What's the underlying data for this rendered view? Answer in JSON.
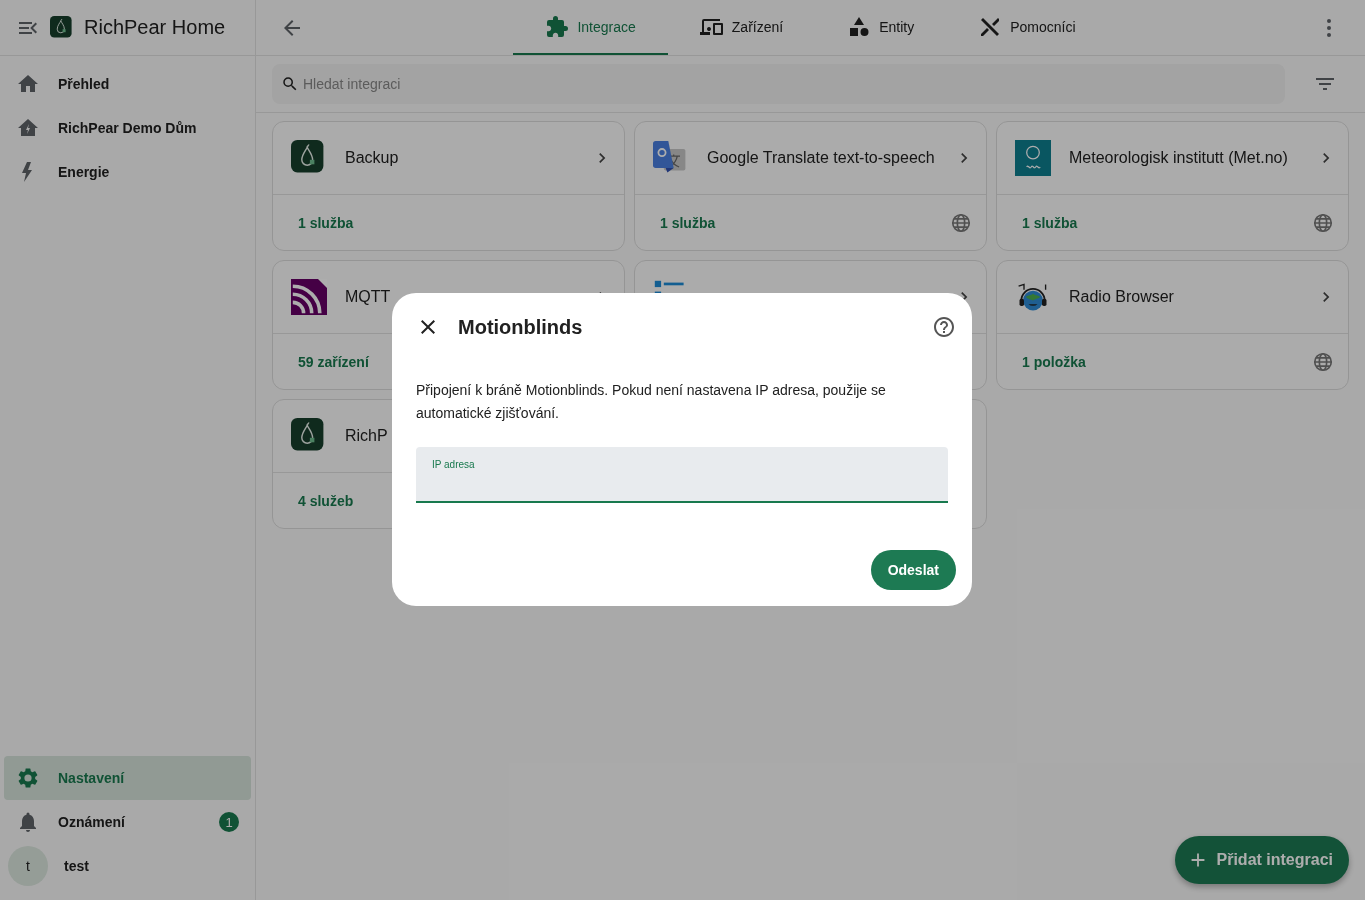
{
  "sidebar": {
    "title": "RichPear Home",
    "items": [
      {
        "label": "Přehled",
        "selected": false
      },
      {
        "label": "RichPear Demo Dům",
        "selected": false
      },
      {
        "label": "Energie",
        "selected": false
      }
    ],
    "bottom_items": [
      {
        "label": "Nastavení",
        "selected": true
      },
      {
        "label": "Oznámení",
        "selected": false,
        "badge": "1"
      }
    ],
    "user": {
      "initial": "t",
      "name": "test"
    }
  },
  "tabs": [
    {
      "label": "Integrace",
      "selected": true
    },
    {
      "label": "Zařízení",
      "selected": false
    },
    {
      "label": "Entity",
      "selected": false
    },
    {
      "label": "Pomocníci",
      "selected": false
    }
  ],
  "search": {
    "placeholder": "Hledat integraci"
  },
  "integrations": [
    {
      "kind": "card",
      "name": "Backup",
      "count": "1 služba",
      "cloud": false
    },
    {
      "kind": "card",
      "name": "Google Translate text-to-speech",
      "count": "1 služba",
      "cloud": true
    },
    {
      "kind": "card",
      "name": "Meteorologisk institutt (Met.no)",
      "count": "1 služba",
      "cloud": true
    },
    {
      "kind": "card",
      "name": "MQTT",
      "count": "59 zařízení",
      "cloud": false
    },
    {
      "kind": "card"
    },
    {
      "kind": "card",
      "name": "Radio Browser",
      "count": "1 položka",
      "cloud": true
    },
    {
      "kind": "card",
      "name": "RichP",
      "count": "4 služeb",
      "cloud": false,
      "arrow": false
    },
    {
      "kind": "empty"
    }
  ],
  "dialog": {
    "title": "Motionblinds",
    "description": "Připojení k bráně Motionblinds. Pokud není nastavena IP adresa, použije se automatické zjišťování.",
    "field_label": "IP adresa",
    "submit": "Odeslat"
  },
  "fab": {
    "label": "Přidat integraci"
  }
}
